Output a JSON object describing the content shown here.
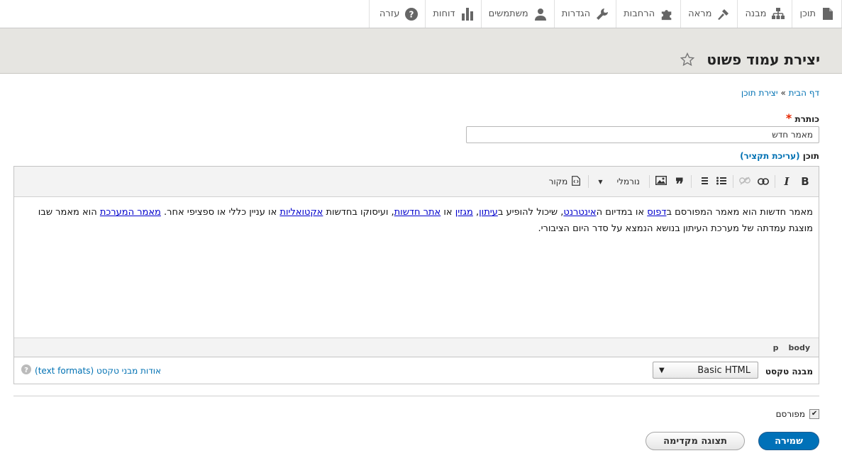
{
  "toolbar": {
    "items": [
      {
        "label": "תוכן",
        "icon": "file-icon"
      },
      {
        "label": "מבנה",
        "icon": "sitemap-icon"
      },
      {
        "label": "מראה",
        "icon": "brush-icon"
      },
      {
        "label": "הרחבות",
        "icon": "puzzle-icon"
      },
      {
        "label": "הגדרות",
        "icon": "wrench-icon"
      },
      {
        "label": "משתמשים",
        "icon": "person-icon"
      },
      {
        "label": "דוחות",
        "icon": "bar-chart-icon"
      },
      {
        "label": "עזרה",
        "icon": "help-icon"
      }
    ]
  },
  "page": {
    "title": "יצירת עמוד פשוט"
  },
  "breadcrumb": {
    "home": "דף הבית",
    "sep": "»",
    "current": "יצירת תוכן"
  },
  "form": {
    "title_label": "כותרת",
    "required_mark": "*",
    "title_value": "מאמר חדש",
    "body_label": "תוכן",
    "summary_link": "(עריכת תקציר)",
    "editor": {
      "format_label": "נורמלי",
      "source_label": "מקור",
      "content": {
        "t1": "מאמר חדשות הוא מאמר המפורסם ב",
        "l1": "דפוס",
        "t2": " או במדיום ה",
        "l2": "אינטרנט",
        "t3": ", שיכול להופיע ב",
        "l3": "עיתון",
        "t4": ", ",
        "l4": "מגזין",
        "t5": " או ",
        "l5": "אתר חדשות",
        "t6": ", ועיסוקו בחדשות ",
        "l6": "אקטואליות",
        "t7": " או עניין כללי או ספציפי אחר. ",
        "l7": "מאמר המערכת",
        "t8": " הוא מאמר שבו מוצגת עמדתה של מערכת העיתון בנושא הנמצא על סדר היום הציבורי."
      },
      "path": [
        "body",
        "p"
      ]
    },
    "text_format_label": "מבנה טקסט",
    "text_format_value": "Basic HTML",
    "text_format_help": "אודות מבני טקסט (text formats)",
    "published_label": "מפורסם",
    "published_checked": true,
    "save_label": "שמירה",
    "preview_label": "תצוגה מקדימה"
  }
}
